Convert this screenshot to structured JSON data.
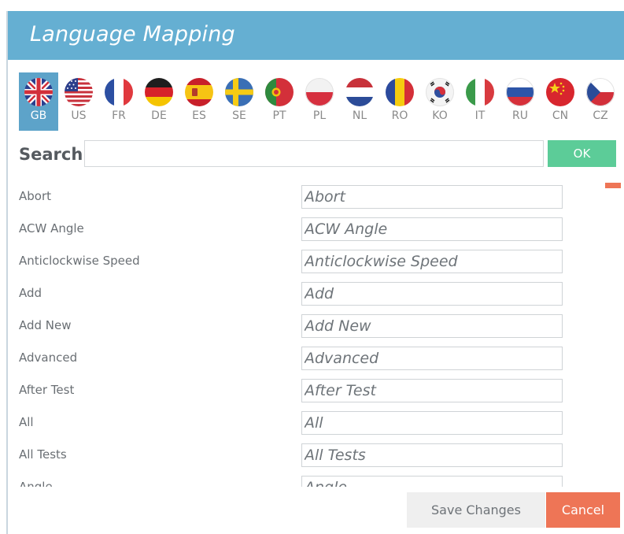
{
  "dialog": {
    "title": "Language Mapping"
  },
  "languages": [
    {
      "code": "GB",
      "selected": true
    },
    {
      "code": "US",
      "selected": false
    },
    {
      "code": "FR",
      "selected": false
    },
    {
      "code": "DE",
      "selected": false
    },
    {
      "code": "ES",
      "selected": false
    },
    {
      "code": "SE",
      "selected": false
    },
    {
      "code": "PT",
      "selected": false
    },
    {
      "code": "PL",
      "selected": false
    },
    {
      "code": "NL",
      "selected": false
    },
    {
      "code": "RO",
      "selected": false
    },
    {
      "code": "KO",
      "selected": false
    },
    {
      "code": "IT",
      "selected": false
    },
    {
      "code": "RU",
      "selected": false
    },
    {
      "code": "CN",
      "selected": false
    },
    {
      "code": "CZ",
      "selected": false
    }
  ],
  "search": {
    "label": "Search",
    "value": "",
    "ok_label": "OK"
  },
  "mappings": [
    {
      "label": "Abort",
      "value": "Abort"
    },
    {
      "label": "ACW Angle",
      "value": "ACW Angle"
    },
    {
      "label": "Anticlockwise Speed",
      "value": "Anticlockwise Speed"
    },
    {
      "label": "Add",
      "value": "Add"
    },
    {
      "label": "Add New",
      "value": "Add New"
    },
    {
      "label": "Advanced",
      "value": "Advanced"
    },
    {
      "label": "After Test",
      "value": "After Test"
    },
    {
      "label": "All",
      "value": "All"
    },
    {
      "label": "All Tests",
      "value": "All Tests"
    },
    {
      "label": "Angle",
      "value": "Angle"
    }
  ],
  "footer": {
    "save_label": "Save Changes",
    "cancel_label": "Cancel"
  },
  "colors": {
    "header": "#65afd2",
    "ok": "#5ccc98",
    "cancel": "#ee7556",
    "selected_flag": "#5da3c9"
  }
}
